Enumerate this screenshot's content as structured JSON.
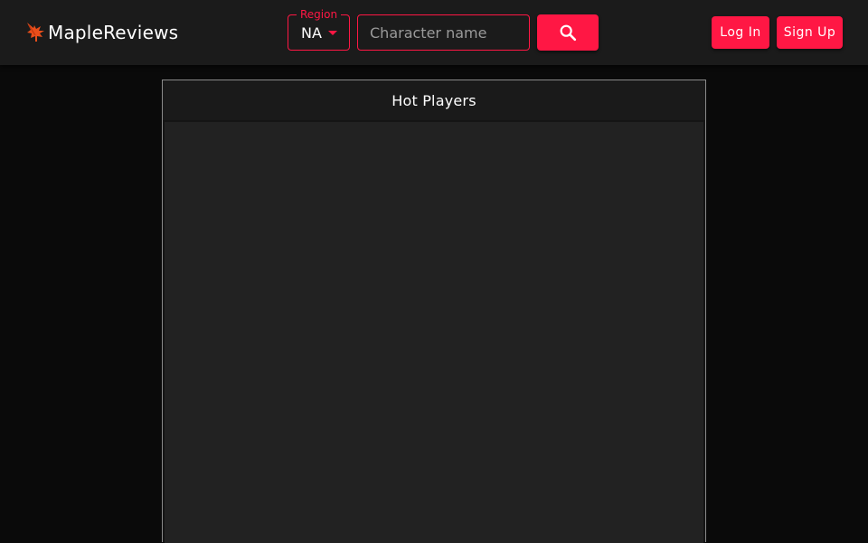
{
  "brand": {
    "name": "MapleReviews",
    "logo_icon": "maple-leaf-icon"
  },
  "search": {
    "region_label": "Region",
    "region_value": "NA",
    "placeholder": "Character name",
    "value": "",
    "button_icon": "search-icon"
  },
  "auth": {
    "login_label": "Log In",
    "signup_label": "Sign Up"
  },
  "panel": {
    "title": "Hot Players"
  },
  "colors": {
    "accent": "#ff1744",
    "header_bg": "#1b1b1b",
    "page_bg": "#0a0a0a",
    "panel_body_bg": "#222222"
  }
}
